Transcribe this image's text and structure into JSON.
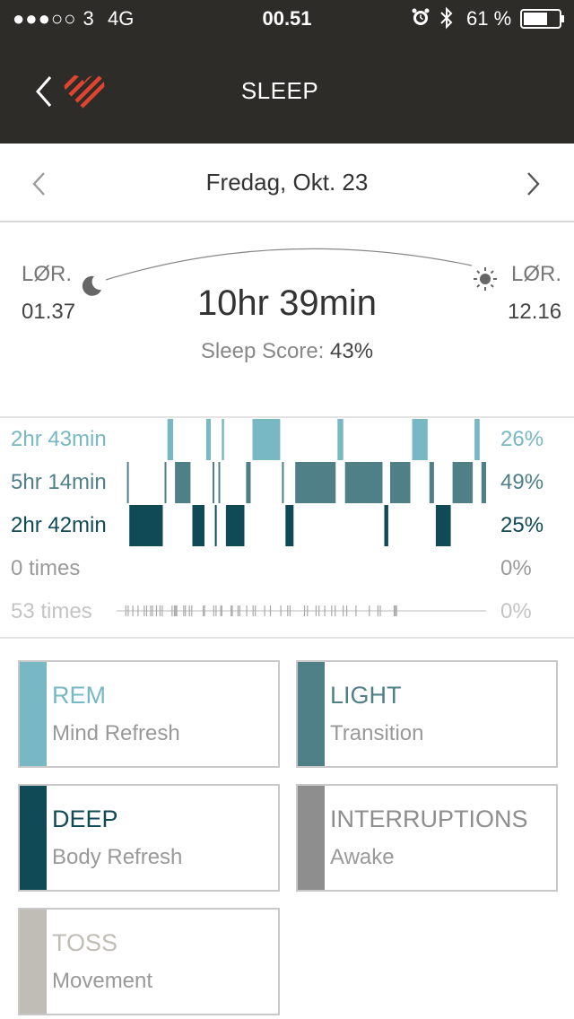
{
  "status_bar": {
    "carrier": "●●●○○ 3",
    "network": "4G",
    "time": "00.51",
    "battery_pct": "61 %"
  },
  "nav": {
    "title": "SLEEP",
    "back_icon": "chevron-left-icon",
    "logo_icon": "heart-logo-icon"
  },
  "date_nav": {
    "label": "Fredag, Okt. 23",
    "prev_icon": "chevron-left-icon",
    "next_icon": "chevron-right-icon"
  },
  "summary": {
    "start_day": "LØR.",
    "start_time": "01.37",
    "end_day": "LØR.",
    "end_time": "12.16",
    "duration": "10hr 39min",
    "score_label": "Sleep Score:",
    "score_value": "43%"
  },
  "rows": [
    {
      "left": "2hr 43min",
      "right": "26%",
      "color": "#77b8c4"
    },
    {
      "left": "5hr 14min",
      "right": "49%",
      "color": "#4f8087"
    },
    {
      "left": "2hr 42min",
      "right": "25%",
      "color": "#104a56"
    },
    {
      "left": "0 times",
      "right": "0%",
      "color": "#9a9a9a"
    },
    {
      "left": "53 times",
      "right": "0%",
      "color": "#c4c4c4"
    }
  ],
  "chart_data": {
    "type": "timeline",
    "stages": [
      "REM",
      "LIGHT",
      "DEEP",
      "INTERRUPTIONS",
      "TOSS"
    ],
    "colors": {
      "REM": "#77b8c4",
      "LIGHT": "#4f8087",
      "DEEP": "#104a56",
      "TOSS": "#a8a8a8"
    },
    "start_time": "01.37",
    "end_time": "12.16",
    "total_minutes": 639,
    "segments": [
      {
        "stage": "LIGHT",
        "start": 18,
        "end": 22
      },
      {
        "stage": "DEEP",
        "start": 22,
        "end": 83
      },
      {
        "stage": "LIGHT",
        "start": 83,
        "end": 88
      },
      {
        "stage": "REM",
        "start": 88,
        "end": 101
      },
      {
        "stage": "LIGHT",
        "start": 101,
        "end": 131
      },
      {
        "stage": "DEEP",
        "start": 131,
        "end": 155
      },
      {
        "stage": "REM",
        "start": 155,
        "end": 166
      },
      {
        "stage": "LIGHT",
        "start": 166,
        "end": 170
      },
      {
        "stage": "DEEP",
        "start": 170,
        "end": 176
      },
      {
        "stage": "LIGHT",
        "start": 176,
        "end": 182
      },
      {
        "stage": "REM",
        "start": 182,
        "end": 189
      },
      {
        "stage": "DEEP",
        "start": 189,
        "end": 224
      },
      {
        "stage": "LIGHT",
        "start": 224,
        "end": 235
      },
      {
        "stage": "REM",
        "start": 235,
        "end": 286
      },
      {
        "stage": "LIGHT",
        "start": 286,
        "end": 292
      },
      {
        "stage": "DEEP",
        "start": 292,
        "end": 309
      },
      {
        "stage": "LIGHT",
        "start": 309,
        "end": 382
      },
      {
        "stage": "REM",
        "start": 382,
        "end": 395
      },
      {
        "stage": "LIGHT",
        "start": 395,
        "end": 463
      },
      {
        "stage": "DEEP",
        "start": 463,
        "end": 473
      },
      {
        "stage": "LIGHT",
        "start": 473,
        "end": 511
      },
      {
        "stage": "REM",
        "start": 511,
        "end": 541
      },
      {
        "stage": "LIGHT",
        "start": 541,
        "end": 552
      },
      {
        "stage": "DEEP",
        "start": 552,
        "end": 581
      },
      {
        "stage": "LIGHT",
        "start": 581,
        "end": 619
      },
      {
        "stage": "REM",
        "start": 619,
        "end": 631
      },
      {
        "stage": "LIGHT",
        "start": 631,
        "end": 651
      },
      {
        "stage": "REM",
        "start": 651,
        "end": 671
      },
      {
        "stage": "LIGHT",
        "start": 671,
        "end": 673
      }
    ],
    "toss_events": [
      16,
      20,
      28,
      37,
      48,
      52,
      59,
      62,
      69,
      75,
      79,
      96,
      100,
      102,
      104,
      116,
      119,
      126,
      130,
      150,
      152,
      168,
      172,
      180,
      182,
      198,
      200,
      210,
      213,
      225,
      236,
      240,
      256,
      266,
      284,
      296,
      300,
      325,
      330,
      345,
      350,
      360,
      372,
      378,
      392,
      398,
      414,
      437,
      452,
      456,
      480,
      482,
      484
    ]
  },
  "legend": [
    {
      "title": "REM",
      "sub": "Mind Refresh",
      "color": "#77b8c4",
      "title_color": "#77b8c4"
    },
    {
      "title": "LIGHT",
      "sub": "Transition",
      "color": "#4f8087",
      "title_color": "#4f8087"
    },
    {
      "title": "DEEP",
      "sub": "Body Refresh",
      "color": "#104a56",
      "title_color": "#104a56"
    },
    {
      "title": "INTERRUPTIONS",
      "sub": "Awake",
      "color": "#8e8e8e",
      "title_color": "#8e8e8e"
    },
    {
      "title": "TOSS",
      "sub": "Movement",
      "color": "#bfbdb5",
      "title_color": "#bfbdb5"
    }
  ]
}
